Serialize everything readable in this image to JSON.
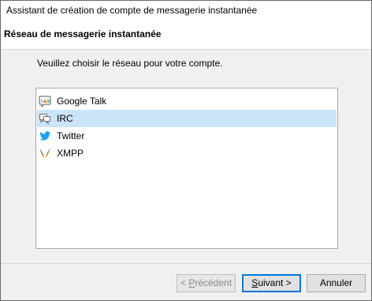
{
  "window": {
    "title": "Assistant de création de compte de messagerie instantanée"
  },
  "header": {
    "heading": "Réseau de messagerie instantanée"
  },
  "main": {
    "prompt": "Veuillez choisir le réseau pour votre compte.",
    "networks": [
      {
        "label": "Google Talk",
        "icon": "google-talk-icon",
        "selected": false
      },
      {
        "label": "IRC",
        "icon": "irc-chat-bubble-icon",
        "selected": true
      },
      {
        "label": "Twitter",
        "icon": "twitter-bird-icon",
        "selected": false
      },
      {
        "label": "XMPP",
        "icon": "xmpp-bulb-icon",
        "selected": false
      }
    ]
  },
  "buttons": {
    "previous": {
      "accesskey": "P",
      "rest": "récédent",
      "prefix": "< ",
      "enabled": false
    },
    "next": {
      "accesskey": "S",
      "rest": "uivant >",
      "enabled": true
    },
    "cancel": {
      "label": "Annuler",
      "enabled": true
    }
  },
  "colors": {
    "selection": "#cce4f7",
    "default_button_border": "#0078d7",
    "twitter": "#1da1f2"
  }
}
